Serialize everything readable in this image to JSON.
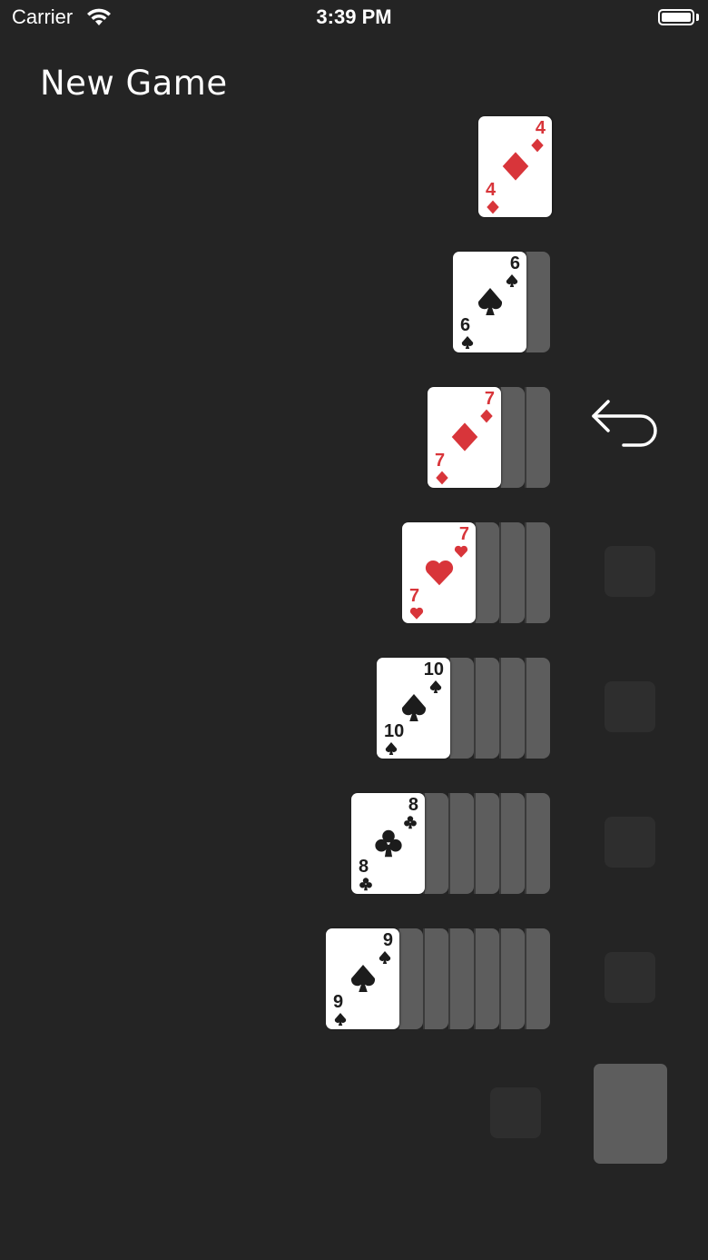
{
  "status_bar": {
    "carrier": "Carrier",
    "time": "3:39 PM",
    "wifi_icon": "wifi-icon",
    "battery_icon": "battery-icon"
  },
  "menu": {
    "new_game_label": "New Game"
  },
  "colors": {
    "background": "#242424",
    "card_face": "#ffffff",
    "card_back": "#5d5d5d",
    "red_suit": "#d8353a",
    "black_suit": "#1c1c1c",
    "empty_slot": "#2e2e2e"
  },
  "tableau": [
    {
      "hidden_count": 0,
      "top_card": {
        "rank": "4",
        "suit": "diamonds",
        "color": "red"
      }
    },
    {
      "hidden_count": 1,
      "top_card": {
        "rank": "6",
        "suit": "spades",
        "color": "black"
      }
    },
    {
      "hidden_count": 2,
      "top_card": {
        "rank": "7",
        "suit": "diamonds",
        "color": "red"
      }
    },
    {
      "hidden_count": 3,
      "top_card": {
        "rank": "7",
        "suit": "hearts",
        "color": "red"
      }
    },
    {
      "hidden_count": 4,
      "top_card": {
        "rank": "10",
        "suit": "spades",
        "color": "black"
      }
    },
    {
      "hidden_count": 5,
      "top_card": {
        "rank": "8",
        "suit": "clubs",
        "color": "black"
      }
    },
    {
      "hidden_count": 6,
      "top_card": {
        "rank": "9",
        "suit": "spades",
        "color": "black"
      }
    }
  ],
  "undo": {
    "icon": "undo-arrow-icon"
  },
  "foundations": {
    "count": 4,
    "empty": true
  },
  "waste": {
    "empty": true
  },
  "stock": {
    "face_down": true
  }
}
